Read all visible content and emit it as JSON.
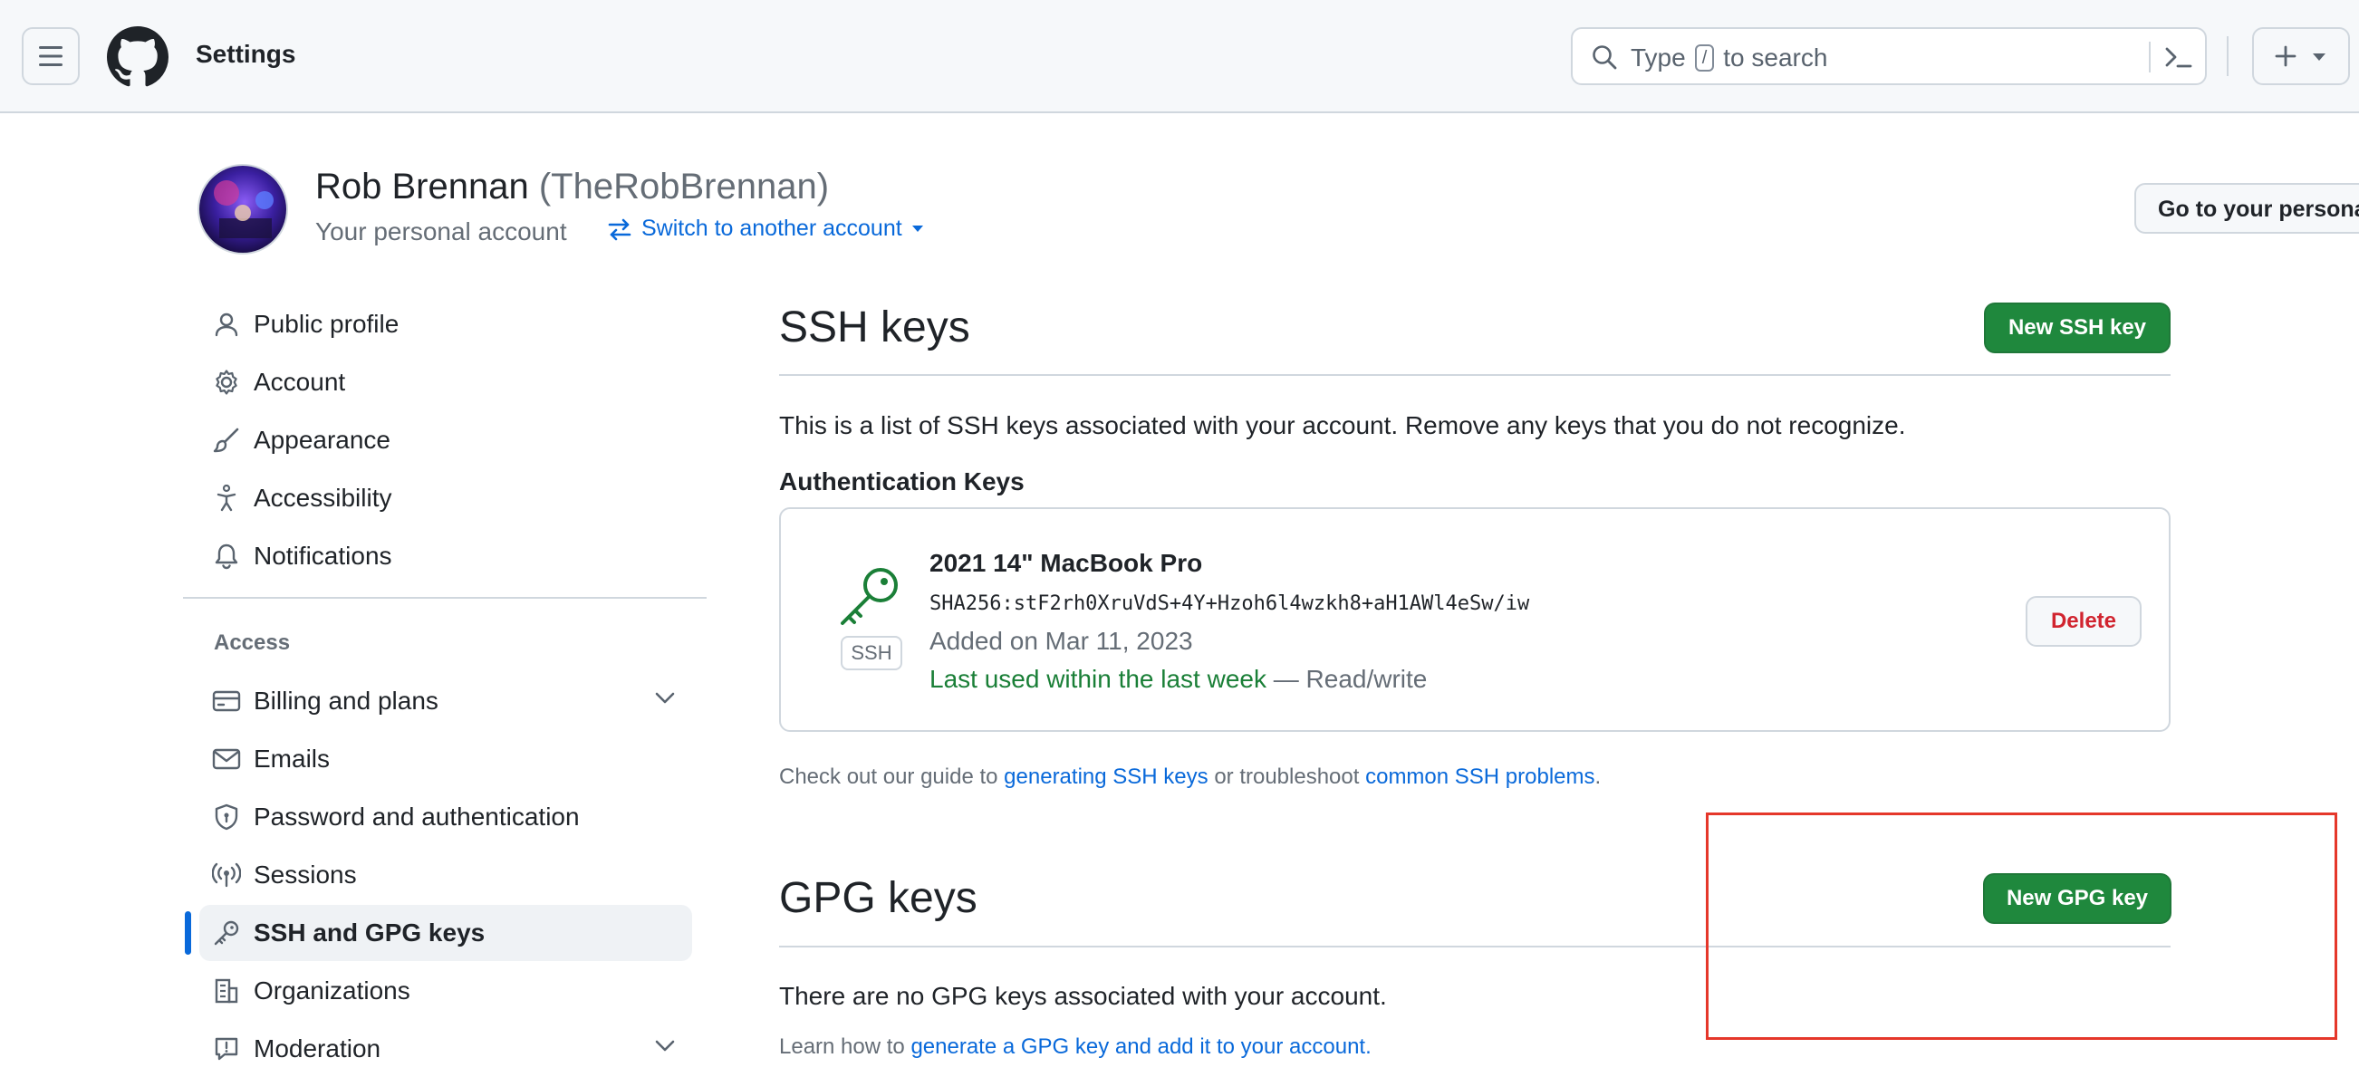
{
  "header": {
    "title": "Settings",
    "search_prefix": "Type",
    "search_key": "/",
    "search_suffix": "to search"
  },
  "profile": {
    "name": "Rob Brennan",
    "login": "(TheRobBrennan)",
    "subtitle": "Your personal account",
    "switch_label": "Switch to another account",
    "goto_label": "Go to your personal profile"
  },
  "sidebar": {
    "items": [
      {
        "label": "Public profile"
      },
      {
        "label": "Account"
      },
      {
        "label": "Appearance"
      },
      {
        "label": "Accessibility"
      },
      {
        "label": "Notifications"
      }
    ],
    "access_heading": "Access",
    "access_items": [
      {
        "label": "Billing and plans"
      },
      {
        "label": "Emails"
      },
      {
        "label": "Password and authentication"
      },
      {
        "label": "Sessions"
      },
      {
        "label": "SSH and GPG keys"
      },
      {
        "label": "Organizations"
      },
      {
        "label": "Moderation"
      }
    ]
  },
  "ssh": {
    "heading": "SSH keys",
    "new_button": "New SSH key",
    "description": "This is a list of SSH keys associated with your account. Remove any keys that you do not recognize.",
    "auth_title": "Authentication Keys",
    "key": {
      "badge": "SSH",
      "title": "2021 14\" MacBook Pro",
      "fingerprint": "SHA256:stF2rh0XruVdS+4Y+Hzoh6l4wzkh8+aH1AWl4eSw/iw",
      "added": "Added on Mar 11, 2023",
      "last_used": "Last used within the last week",
      "access": "— Read/write",
      "delete_label": "Delete"
    },
    "guide_prefix": "Check out our guide to",
    "guide_link1": "generating SSH keys",
    "guide_mid": "or troubleshoot",
    "guide_link2": "common SSH problems",
    "guide_suffix": "."
  },
  "gpg": {
    "heading": "GPG keys",
    "new_button": "New GPG key",
    "empty": "There are no GPG keys associated with your account.",
    "learn_prefix": "Learn how to",
    "learn_link": "generate a GPG key and add it to your account",
    "learn_suffix": "."
  },
  "colors": {
    "accent": "#0969da",
    "primary_button": "#1f883d",
    "danger": "#d1242f",
    "success": "#1a7f37",
    "highlight": "#e5372a"
  }
}
